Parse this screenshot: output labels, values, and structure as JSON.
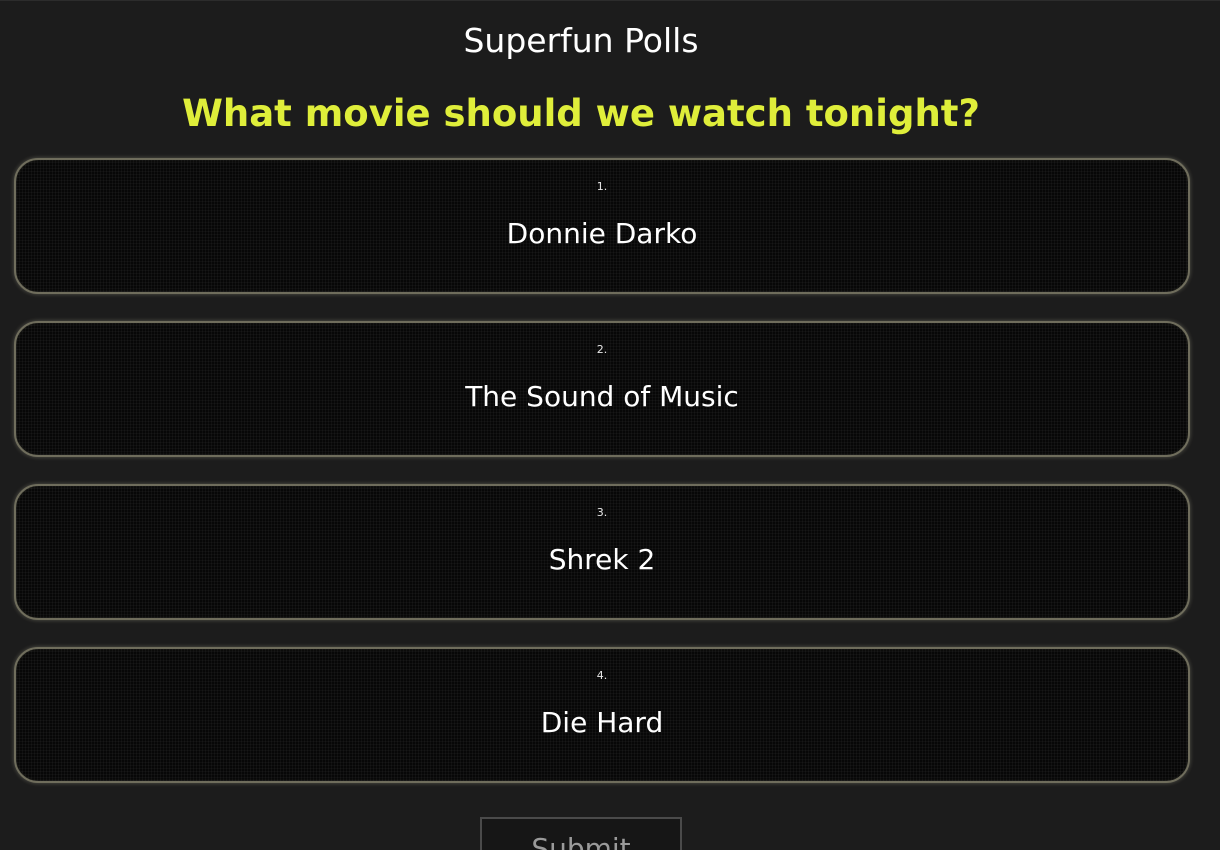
{
  "app": {
    "title": "Superfun Polls"
  },
  "poll": {
    "question": "What movie should we watch tonight?",
    "options": [
      {
        "number": "1.",
        "label": "Donnie Darko"
      },
      {
        "number": "2.",
        "label": "The Sound of Music"
      },
      {
        "number": "3.",
        "label": "Shrek 2"
      },
      {
        "number": "4.",
        "label": "Die Hard"
      }
    ],
    "submit_label": "Submit"
  },
  "colors": {
    "background": "#1c1c1c",
    "question": "#dfee3a",
    "option_border": "#6f6d5c"
  }
}
